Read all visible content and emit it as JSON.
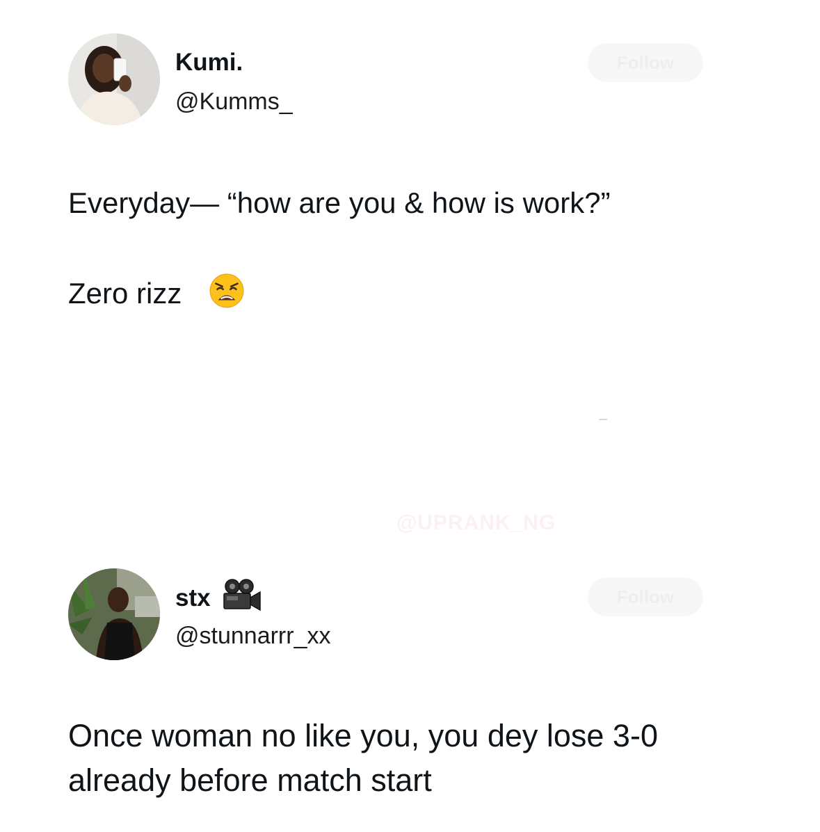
{
  "tweets": [
    {
      "display_name": "Kumi.",
      "handle": "@Kumms_",
      "follow_label": "Follow",
      "lines": [
        "Everyday— “how are you & how is work?”",
        "Zero rizz"
      ],
      "trailing_emoji": "weary-face-icon"
    },
    {
      "display_name": "stx",
      "name_emoji": "movie-camera-icon",
      "handle": "@stunnarrr_xx",
      "follow_label": "Follow",
      "lines": [
        "Once woman no like you, you dey lose 3-0",
        "already before match start"
      ]
    }
  ],
  "watermark": "@UPRANK_NG",
  "colors": {
    "text": "#0f1419",
    "follow_bg": "#f7f7f8",
    "background": "#ffffff"
  }
}
